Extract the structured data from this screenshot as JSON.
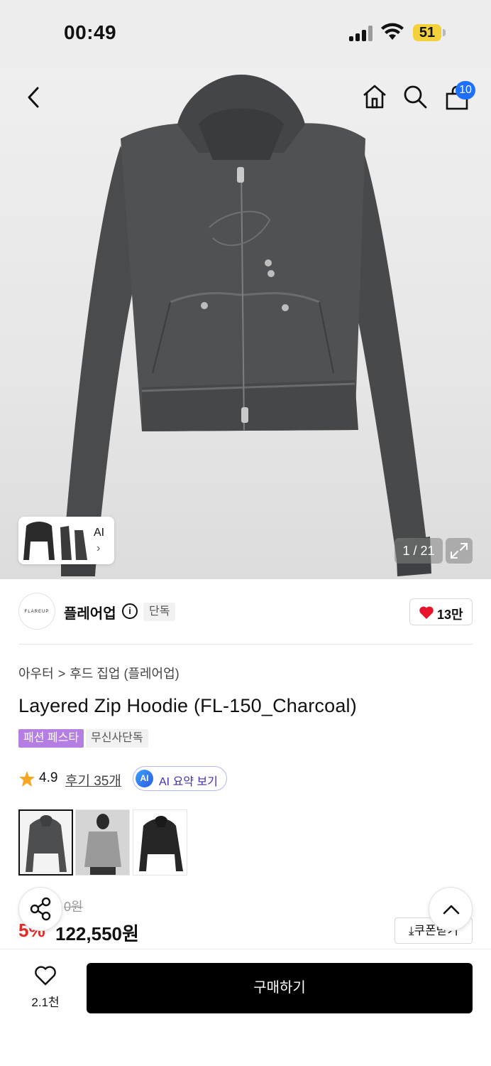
{
  "status_bar": {
    "time": "00:49",
    "battery": "51"
  },
  "header": {
    "cart_count": "10"
  },
  "gallery": {
    "ai_label": "AI",
    "ai_chevron": "›",
    "counter": "1 / 21"
  },
  "brand": {
    "logo_text": "FLAREUP",
    "name": "플레어업",
    "tag": "단독",
    "likes": "13만"
  },
  "product": {
    "breadcrumb": [
      "아우터",
      "후드 집업 (플레어업)"
    ],
    "breadcrumb_sep": ">",
    "title": "Layered Zip Hoodie (FL-150_Charcoal)",
    "tags": [
      "패션 페스타",
      "무신사단독"
    ],
    "rating": "4.9",
    "reviews_link": "후기 35개",
    "ai_summary_badge": "AI",
    "ai_summary_label": "AI 요약 보기",
    "variants": [
      "charcoal",
      "gray",
      "black"
    ],
    "original_price": "0원",
    "discount": "5%",
    "price": "122,550원",
    "coupon_button": "⤓쿠폰받기"
  },
  "bottom_bar": {
    "wish_count": "2.1천",
    "buy_label": "구매하기"
  },
  "colors": {
    "accent_blue": "#1f6fff",
    "sale_red": "#e52a2a",
    "festa_purple": "#b57ee3",
    "heart_red": "#e8132b"
  }
}
